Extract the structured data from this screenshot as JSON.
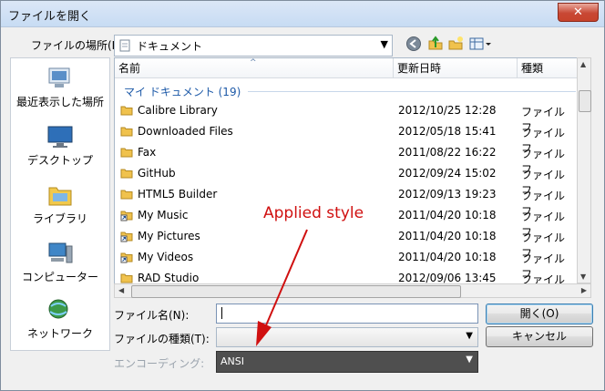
{
  "window": {
    "title": "ファイルを開く",
    "close_glyph": "✕"
  },
  "toolbar": {
    "lookin_label": "ファイルの場所(I):",
    "lookin_value": "ドキュメント",
    "icons": [
      "back-icon",
      "up-folder-icon",
      "new-folder-icon",
      "view-menu-icon"
    ]
  },
  "places": [
    {
      "label": "最近表示した場所",
      "icon": "recent-places-icon"
    },
    {
      "label": "デスクトップ",
      "icon": "desktop-icon"
    },
    {
      "label": "ライブラリ",
      "icon": "libraries-icon"
    },
    {
      "label": "コンピューター",
      "icon": "computer-icon"
    },
    {
      "label": "ネットワーク",
      "icon": "network-icon"
    }
  ],
  "list": {
    "columns": {
      "name": "名前",
      "date": "更新日時",
      "type": "種類"
    },
    "group": "マイ ドキュメント (19)",
    "rows": [
      {
        "name": "Calibre Library",
        "date": "2012/10/25 12:28",
        "type": "ファイル フ",
        "icon": "folder-icon"
      },
      {
        "name": "Downloaded Files",
        "date": "2012/05/18 15:41",
        "type": "ファイル フ",
        "icon": "folder-icon"
      },
      {
        "name": "Fax",
        "date": "2011/08/22 16:22",
        "type": "ファイル フ",
        "icon": "folder-icon"
      },
      {
        "name": "GitHub",
        "date": "2012/09/24 15:02",
        "type": "ファイル フ",
        "icon": "folder-icon"
      },
      {
        "name": "HTML5 Builder",
        "date": "2012/09/13 19:23",
        "type": "ファイル フ",
        "icon": "folder-icon"
      },
      {
        "name": "My Music",
        "date": "2011/04/20 10:18",
        "type": "ファイル フ",
        "icon": "shortcut-icon"
      },
      {
        "name": "My Pictures",
        "date": "2011/04/20 10:18",
        "type": "ファイル フ",
        "icon": "shortcut-icon"
      },
      {
        "name": "My Videos",
        "date": "2011/04/20 10:18",
        "type": "ファイル フ",
        "icon": "shortcut-icon"
      },
      {
        "name": "RAD Studio",
        "date": "2012/09/06 13:45",
        "type": "ファイル フ",
        "icon": "folder-icon"
      }
    ]
  },
  "form": {
    "filename_label": "ファイル名(N):",
    "filename_value": "",
    "filetype_label": "ファイルの種類(T):",
    "filetype_value": "",
    "encoding_label": "エンコーディング:",
    "encoding_value": "ANSI"
  },
  "buttons": {
    "open": "開く(O)",
    "cancel": "キャンセル"
  },
  "annotation": {
    "text": "Applied style",
    "color": "#d01010"
  }
}
